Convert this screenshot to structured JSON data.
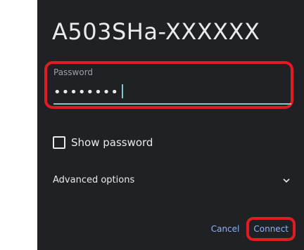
{
  "dialog": {
    "title": "A503SHa-XXXXXX",
    "password_field": {
      "label": "Password",
      "value": "••••••••"
    },
    "show_password_label": "Show password",
    "advanced_options_label": "Advanced options",
    "buttons": {
      "cancel": "Cancel",
      "connect": "Connect"
    },
    "colors": {
      "background": "#202124",
      "accent": "#80cbc4",
      "button_text": "#8ab4f8",
      "highlight": "#e11b22"
    },
    "icons": {
      "advanced_options": "chevron-down-icon"
    }
  }
}
